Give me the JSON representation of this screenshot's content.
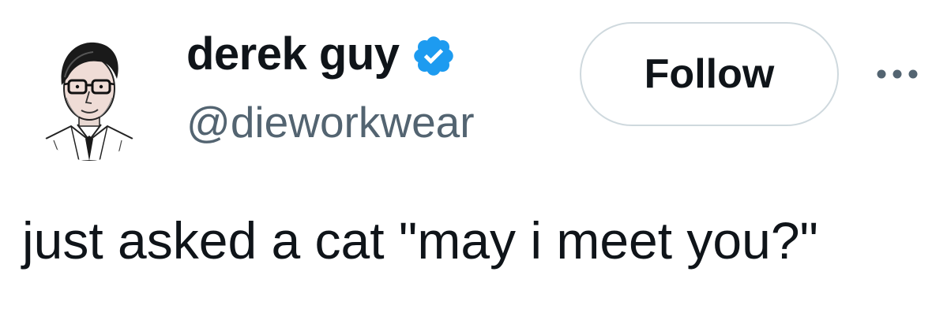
{
  "author": {
    "display_name": "derek guy",
    "handle": "@dieworkwear",
    "verified": true,
    "avatar_icon": "sketch-portrait-avatar"
  },
  "actions": {
    "follow_label": "Follow",
    "more_icon": "more-options-icon"
  },
  "tweet": {
    "text": "just asked a cat \"may i meet you?\""
  },
  "colors": {
    "text_primary": "#0f1419",
    "text_secondary": "#536471",
    "verified_blue": "#1d9bf0",
    "button_border": "#cfd9de"
  }
}
